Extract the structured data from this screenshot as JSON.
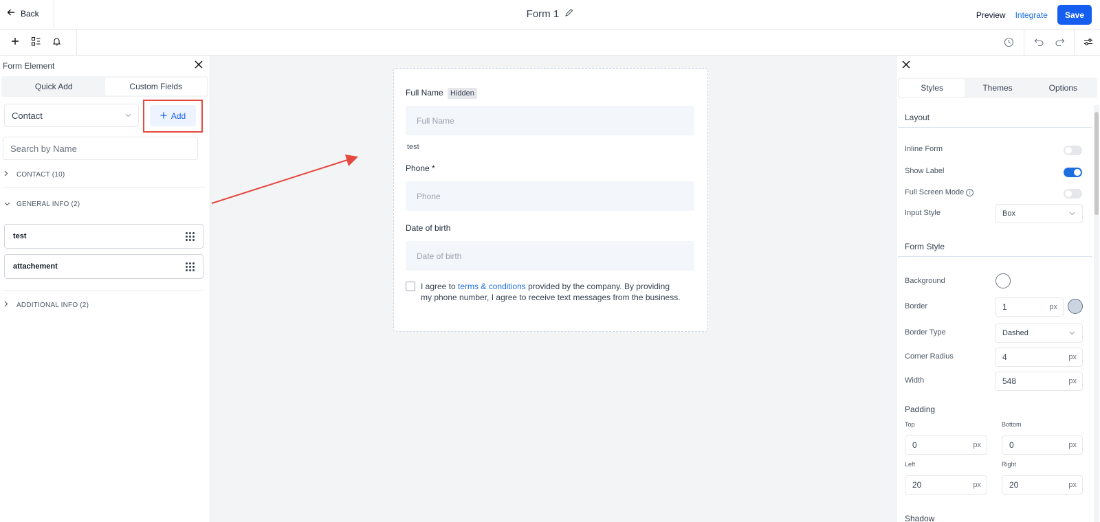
{
  "header": {
    "back_label": "Back",
    "title": "Form 1",
    "preview_label": "Preview",
    "integrate_label": "Integrate",
    "save_label": "Save"
  },
  "toolbar": {
    "left_icons": [
      "plus-icon",
      "elements-icon",
      "bell-icon"
    ],
    "right_icons": [
      "history-icon",
      "undo-icon",
      "redo-icon",
      "settings-sliders-icon"
    ]
  },
  "left_panel": {
    "title": "Form Element",
    "tabs": [
      {
        "label": "Quick Add",
        "active": false
      },
      {
        "label": "Custom Fields",
        "active": true
      }
    ],
    "object_select": "Contact",
    "add_label": "Add",
    "search_placeholder": "Search by Name",
    "groups": [
      {
        "label": "CONTACT (10)",
        "expanded": false
      },
      {
        "label": "GENERAL INFO (2)",
        "expanded": true,
        "items": [
          "test",
          "attachement"
        ]
      },
      {
        "label": "ADDITIONAL INFO (2)",
        "expanded": false
      }
    ]
  },
  "form": {
    "fields": [
      {
        "label": "Full Name",
        "tag": "Hidden",
        "placeholder": "Full Name",
        "sub": "test"
      },
      {
        "label": "Phone *",
        "placeholder": "Phone"
      },
      {
        "label": "Date of birth",
        "placeholder": "Date of birth"
      }
    ],
    "consent": {
      "before": "I agree to ",
      "link": "terms & conditions",
      "after": " provided by the company. By providing my phone number, I agree to receive text messages from the business."
    }
  },
  "right_panel": {
    "tabs": [
      {
        "label": "Styles",
        "active": true
      },
      {
        "label": "Themes",
        "active": false
      },
      {
        "label": "Options",
        "active": false
      }
    ],
    "layout": {
      "title": "Layout",
      "inline_form": {
        "label": "Inline Form",
        "on": false
      },
      "show_label": {
        "label": "Show Label",
        "on": true
      },
      "full_screen": {
        "label": "Full Screen Mode",
        "on": false
      },
      "input_style": {
        "label": "Input Style",
        "value": "Box"
      }
    },
    "form_style": {
      "title": "Form Style",
      "background_label": "Background",
      "background_color": "#ffffff",
      "border_label": "Border",
      "border_value": "1",
      "border_color": "#cbd5e1",
      "border_type_label": "Border Type",
      "border_type_value": "Dashed",
      "corner_radius_label": "Corner Radius",
      "corner_radius_value": "4",
      "width_label": "Width",
      "width_value": "548",
      "unit": "px"
    },
    "padding": {
      "title": "Padding",
      "top_label": "Top",
      "top_value": "0",
      "bottom_label": "Bottom",
      "bottom_value": "0",
      "left_label": "Left",
      "left_value": "20",
      "right_label": "Right",
      "right_value": "20"
    },
    "shadow_title": "Shadow"
  },
  "colors": {
    "accent": "#155eef",
    "annotation": "#e5483d"
  }
}
